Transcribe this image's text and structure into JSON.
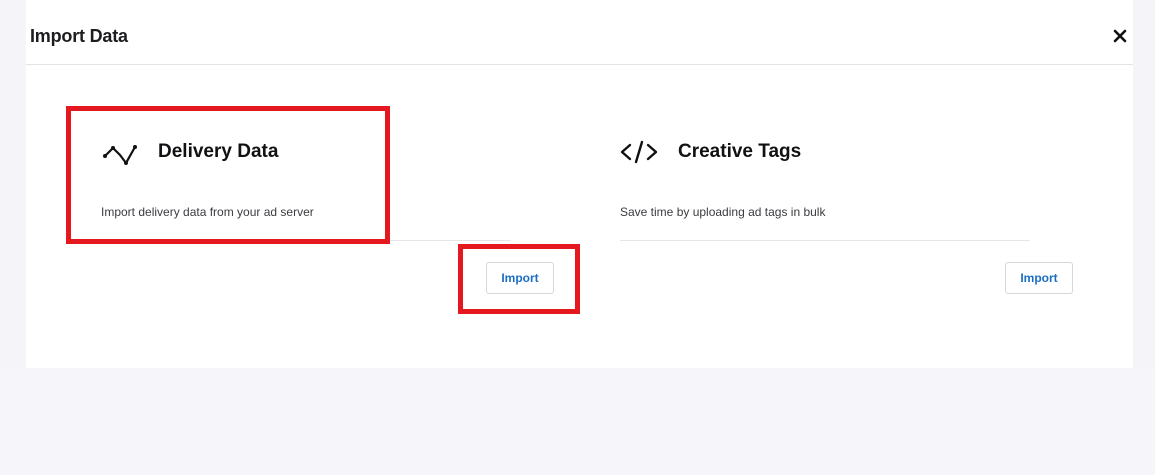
{
  "dialog": {
    "title": "Import Data",
    "close_icon": "close-icon"
  },
  "cards": [
    {
      "title": "Delivery Data",
      "description": "Import delivery data from your ad server",
      "icon": "line-chart-icon",
      "button_label": "Import"
    },
    {
      "title": "Creative Tags",
      "description": "Save time by uploading ad tags in bulk",
      "icon": "code-icon",
      "button_label": "Import"
    }
  ],
  "colors": {
    "accent": "#1a6fc4",
    "highlight": "#e3191f"
  }
}
